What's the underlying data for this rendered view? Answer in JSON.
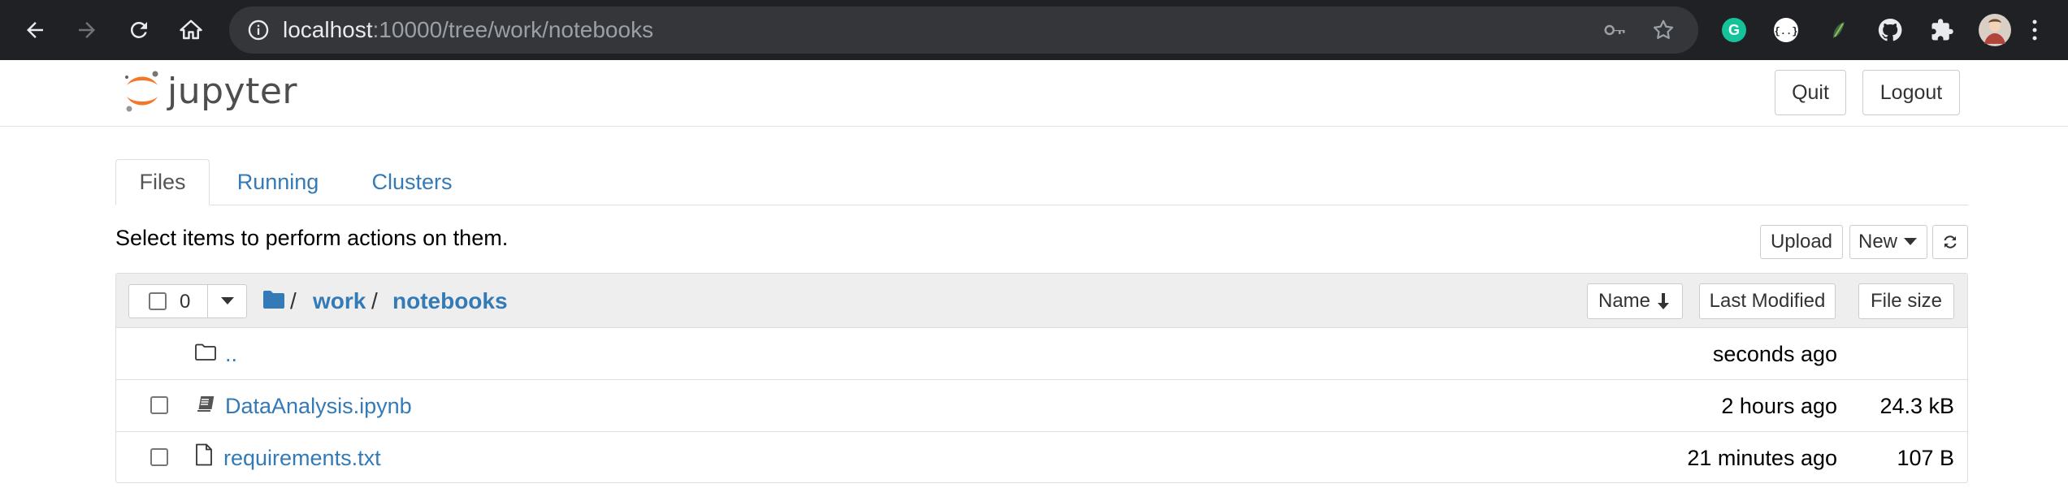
{
  "browser": {
    "url_host": "localhost",
    "url_path": ":10000/tree/work/notebooks"
  },
  "header": {
    "logo_text": "jupyter",
    "quit_label": "Quit",
    "logout_label": "Logout"
  },
  "tabs": [
    {
      "label": "Files",
      "active": true
    },
    {
      "label": "Running",
      "active": false
    },
    {
      "label": "Clusters",
      "active": false
    }
  ],
  "toolbar": {
    "select_message": "Select items to perform actions on them.",
    "upload_label": "Upload",
    "new_label": "New",
    "refresh_icon": "refresh-icon"
  },
  "list_header": {
    "selected_count": "0",
    "root_sep": "/",
    "breadcrumbs": [
      "work",
      "notebooks"
    ],
    "sep": "/",
    "sort_name": "Name",
    "sort_modified": "Last Modified",
    "sort_size": "File size"
  },
  "rows": [
    {
      "name": "..",
      "modified": "seconds ago",
      "size": "",
      "icon": "folder-icon"
    },
    {
      "name": "DataAnalysis.ipynb",
      "modified": "2 hours ago",
      "size": "24.3 kB",
      "icon": "notebook-icon"
    },
    {
      "name": "requirements.txt",
      "modified": "21 minutes ago",
      "size": "107 B",
      "icon": "file-icon"
    }
  ],
  "colors": {
    "link": "#337ab7",
    "chrome": "#202124",
    "jupyter_orange": "#f37726"
  }
}
